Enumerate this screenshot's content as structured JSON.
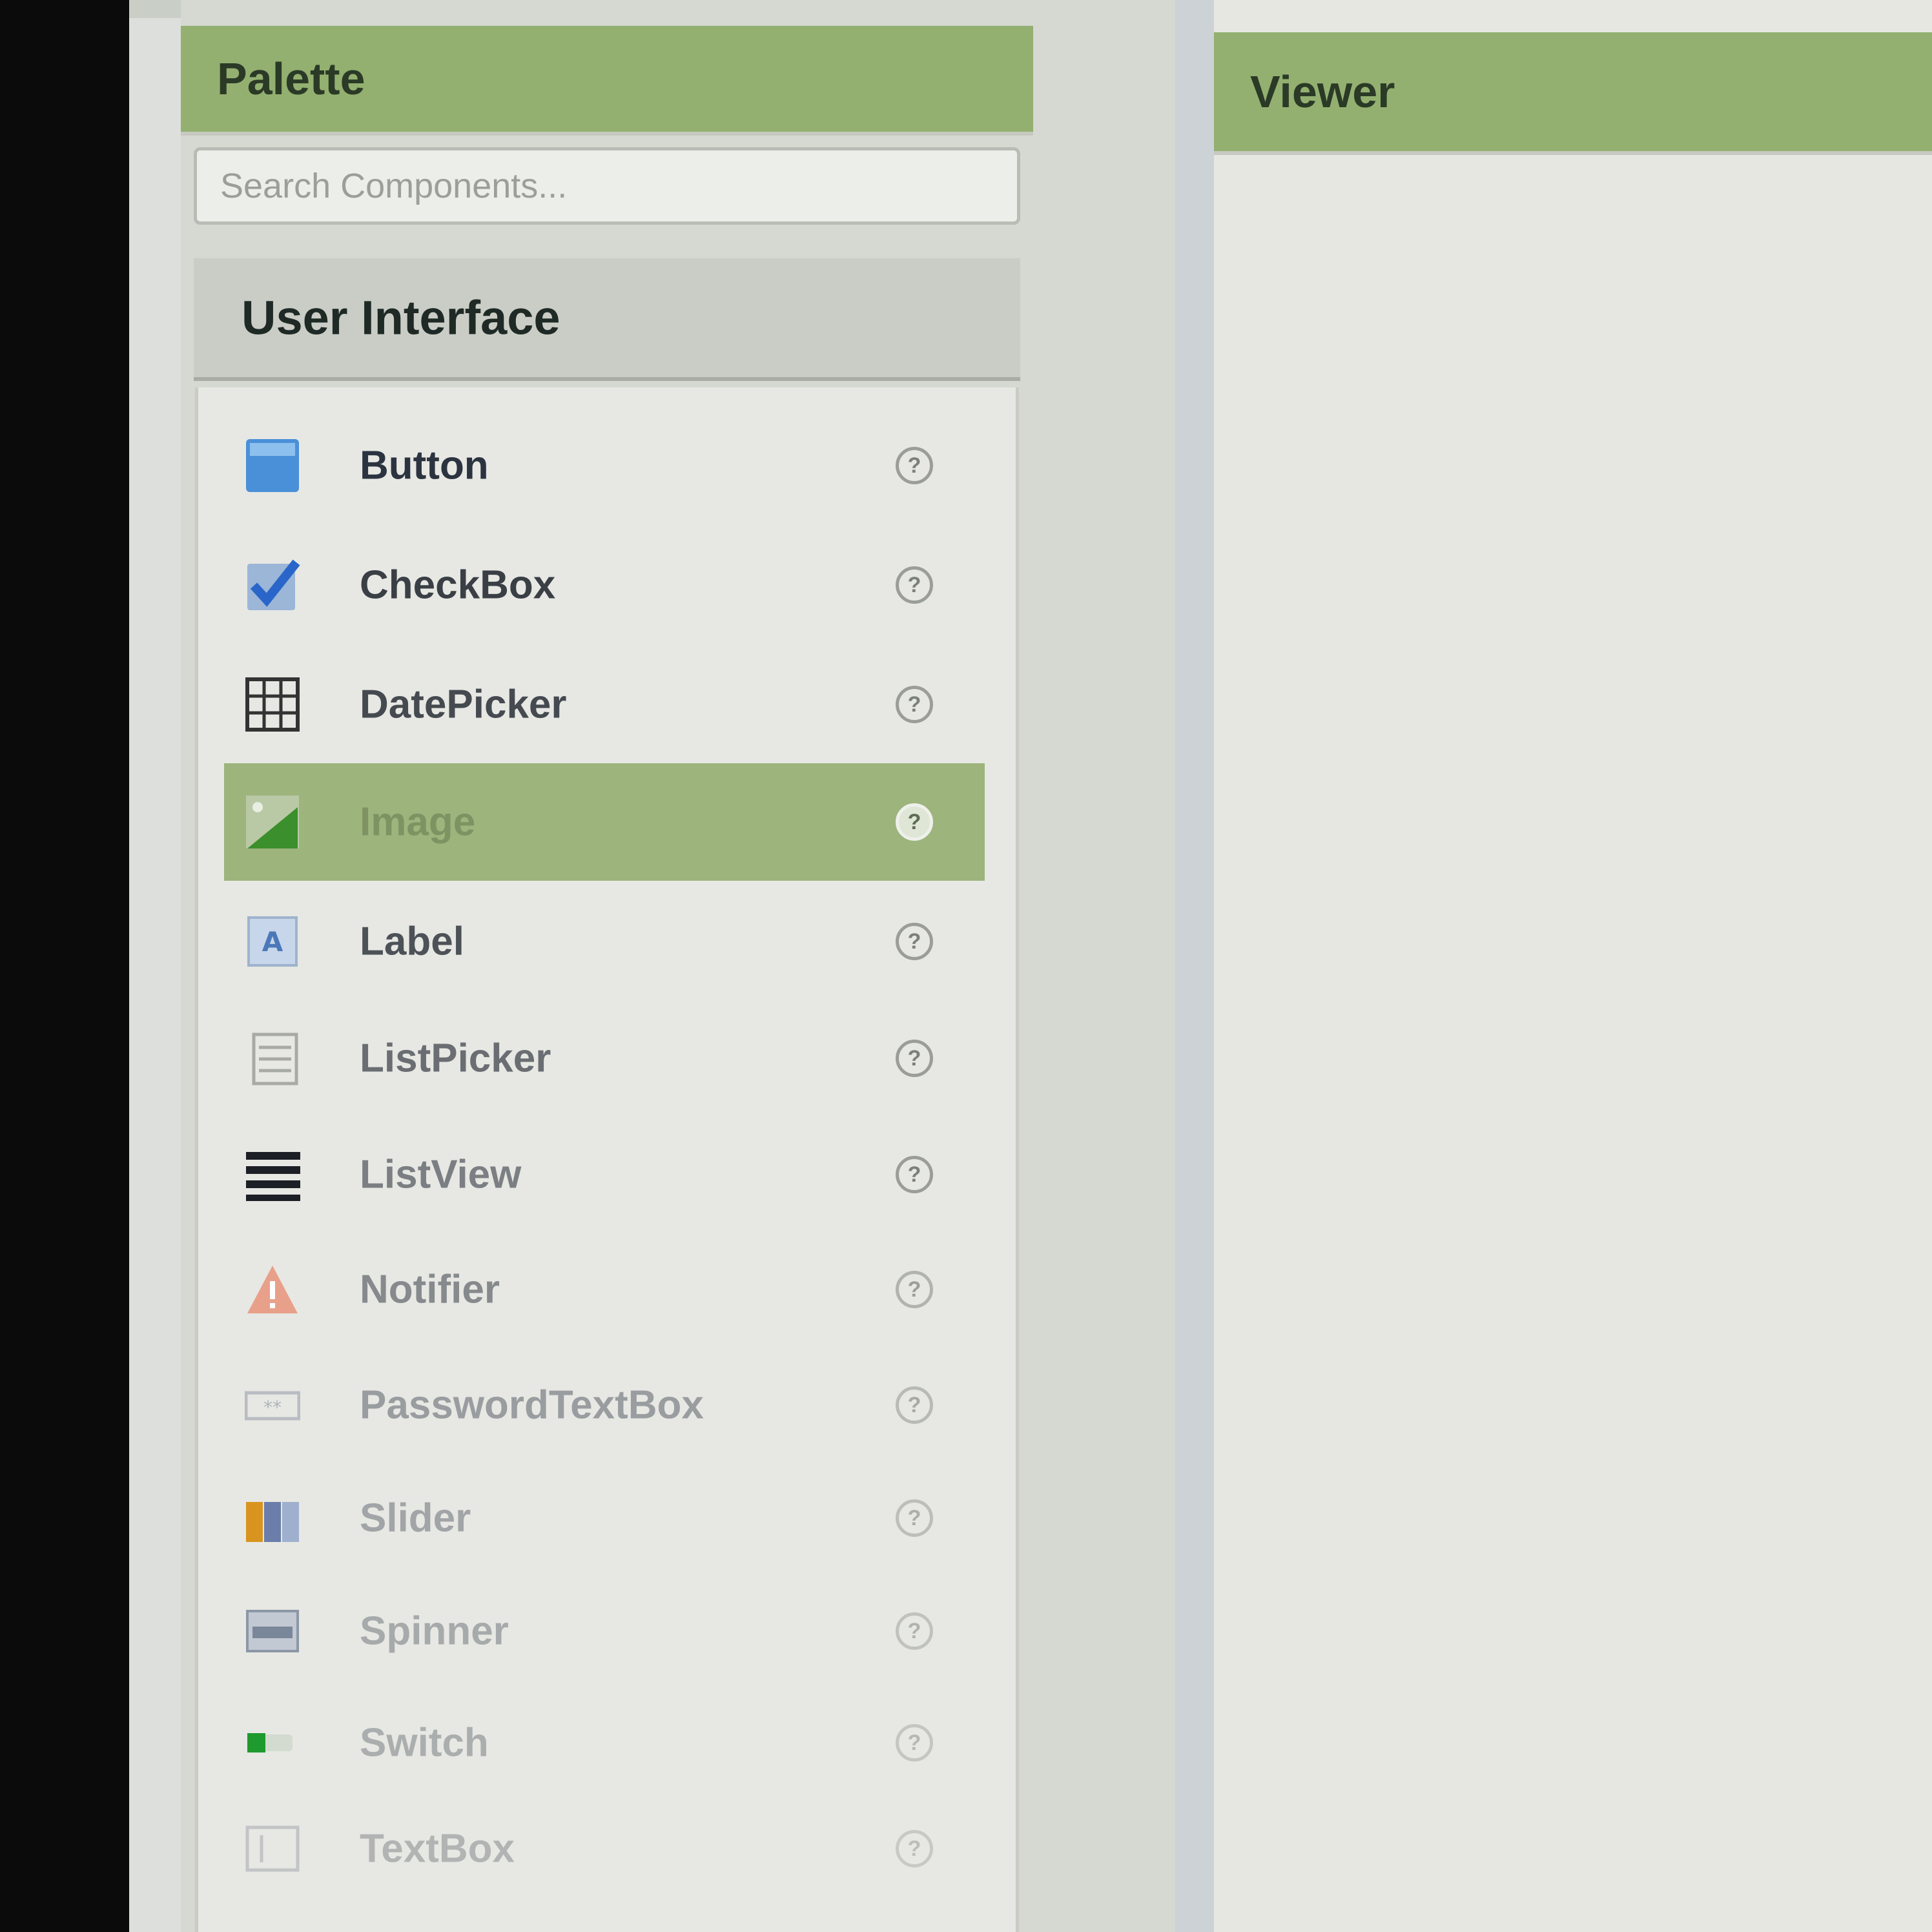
{
  "palette": {
    "title": "Palette",
    "search_placeholder": "Search Components...",
    "drawer_title": "User Interface",
    "items": [
      {
        "label": "Button",
        "icon": "button-icon",
        "selected": false
      },
      {
        "label": "CheckBox",
        "icon": "checkbox-icon",
        "selected": false
      },
      {
        "label": "DatePicker",
        "icon": "datepicker-icon",
        "selected": false
      },
      {
        "label": "Image",
        "icon": "image-icon",
        "selected": true
      },
      {
        "label": "Label",
        "icon": "label-icon",
        "selected": false
      },
      {
        "label": "ListPicker",
        "icon": "listpicker-icon",
        "selected": false
      },
      {
        "label": "ListView",
        "icon": "listview-icon",
        "selected": false
      },
      {
        "label": "Notifier",
        "icon": "notifier-icon",
        "selected": false
      },
      {
        "label": "PasswordTextBox",
        "icon": "passwordtextbox-icon",
        "selected": false
      },
      {
        "label": "Slider",
        "icon": "slider-icon",
        "selected": false
      },
      {
        "label": "Spinner",
        "icon": "spinner-icon",
        "selected": false
      },
      {
        "label": "Switch",
        "icon": "switch-icon",
        "selected": false
      },
      {
        "label": "TextBox",
        "icon": "textbox-icon",
        "selected": false
      }
    ],
    "help_glyph": "?"
  },
  "viewer": {
    "title": "Viewer"
  },
  "colors": {
    "header_green": "#93b070",
    "selected_green": "#9db47d",
    "button_blue": "#4a90d9"
  }
}
